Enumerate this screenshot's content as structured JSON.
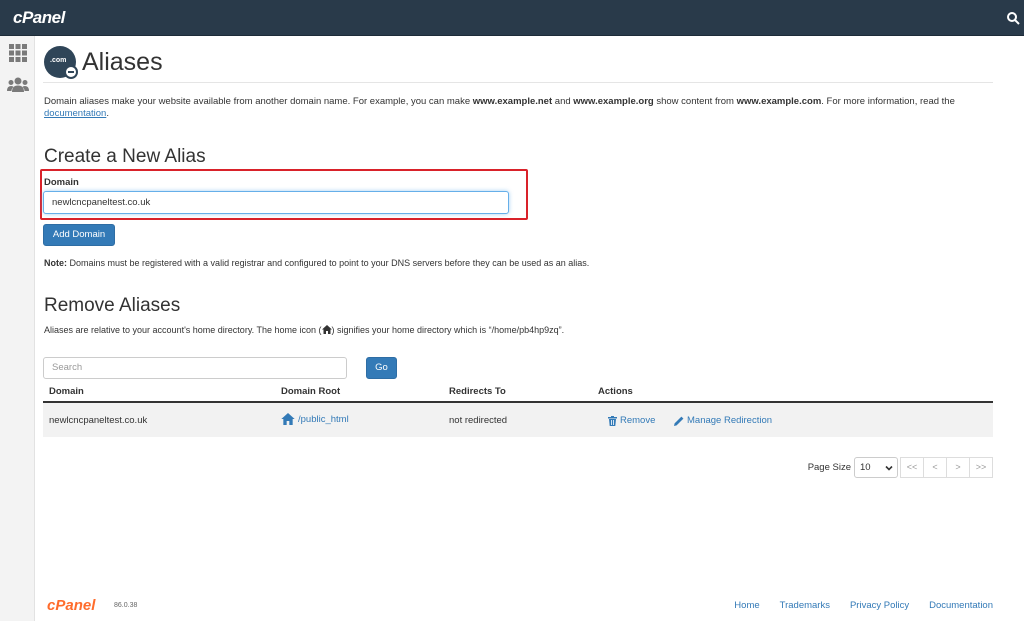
{
  "topbar": {
    "brand": "cPanel"
  },
  "page": {
    "title": "Aliases",
    "icon_text": ".com"
  },
  "intro": {
    "t1": "Domain aliases make your website available from another domain name. For example, you can make ",
    "b1": "www.example.net",
    "t2": " and ",
    "b2": "www.example.org",
    "t3": " show content from ",
    "b3": "www.example.com",
    "t4": ". For more information, read the ",
    "link": "documentation",
    "t5": "."
  },
  "create": {
    "heading": "Create a New Alias",
    "label": "Domain",
    "value": "newlcncpaneltest.co.uk",
    "button": "Add Domain",
    "note_bold": "Note:",
    "note_text": " Domains must be registered with a valid registrar and configured to point to your DNS servers before they can be used as an alias."
  },
  "remove": {
    "heading": "Remove Aliases",
    "desc_before": "Aliases are relative to your account's home directory. The home icon (",
    "desc_after": ") signifies your home directory which is “/home/pb4hp9zq”.",
    "search_placeholder": "Search",
    "go": "Go",
    "columns": [
      "Domain",
      "Domain Root",
      "Redirects To",
      "Actions"
    ],
    "rows": [
      {
        "domain": "newlcncpaneltest.co.uk",
        "root": "/public_html",
        "redirects": "not redirected",
        "remove": "Remove",
        "manage": "Manage Redirection"
      }
    ],
    "page_size_label": "Page Size",
    "page_size": "10",
    "pager": [
      "<<",
      "<",
      ">",
      ">>"
    ]
  },
  "footer": {
    "logo": "cPanel",
    "version": "86.0.38",
    "links": [
      "Home",
      "Trademarks",
      "Privacy Policy",
      "Documentation"
    ]
  },
  "colors": {
    "topbar": "#293a4a",
    "accent": "#337ab7",
    "highlight": "#d9222a",
    "footer_logo": "#ff6c2c"
  }
}
